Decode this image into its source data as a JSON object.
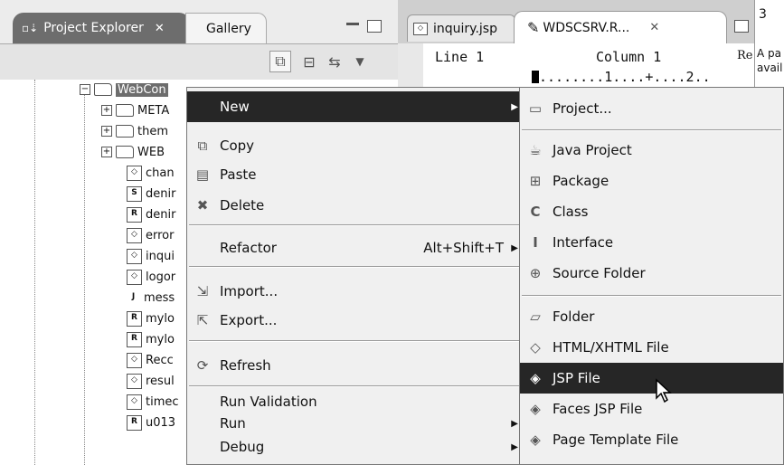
{
  "left_panel": {
    "tabs": [
      {
        "label": "Project Explorer",
        "close": "✕"
      },
      {
        "label": "Gallery"
      }
    ],
    "tree": {
      "root": "WebCon",
      "children": [
        {
          "label": "META",
          "kind": "folder"
        },
        {
          "label": "them",
          "kind": "folder"
        },
        {
          "label": "WEB",
          "kind": "folder"
        },
        {
          "label": "chan",
          "kind": "file",
          "glyph": "◇"
        },
        {
          "label": "denir",
          "kind": "file",
          "glyph": "S"
        },
        {
          "label": "denir",
          "kind": "file",
          "glyph": "R"
        },
        {
          "label": "error",
          "kind": "file",
          "glyph": "◇"
        },
        {
          "label": "inqui",
          "kind": "file",
          "glyph": "◇"
        },
        {
          "label": "logor",
          "kind": "file",
          "glyph": "◇"
        },
        {
          "label": "mess",
          "kind": "file",
          "glyph": "J"
        },
        {
          "label": "mylo",
          "kind": "file",
          "glyph": "R"
        },
        {
          "label": "mylo",
          "kind": "file",
          "glyph": "R"
        },
        {
          "label": "Recc",
          "kind": "file",
          "glyph": "◇"
        },
        {
          "label": "resul",
          "kind": "file",
          "glyph": "◇"
        },
        {
          "label": "timec",
          "kind": "file",
          "glyph": "◇"
        },
        {
          "label": "u013",
          "kind": "file",
          "glyph": "R"
        }
      ]
    }
  },
  "editor": {
    "tabs": [
      {
        "label": "inquiry.jsp"
      },
      {
        "label": "WDSCSRV.R...",
        "close": "✕"
      }
    ],
    "line_label": "Line 1",
    "column_label": "Column 1",
    "re_label": "Re",
    "ruler": "........1....+....2.."
  },
  "far_right": {
    "tab_label": "3",
    "text_line1": "A pa",
    "text_line2": "avail"
  },
  "context_menu": {
    "items": [
      {
        "label": "New",
        "icon": "",
        "arrow": "▶",
        "highlight": true
      },
      {
        "label": "Copy",
        "icon": "copy-icon"
      },
      {
        "label": "Paste",
        "icon": "paste-icon"
      },
      {
        "label": "Delete",
        "icon": "delete-icon"
      },
      {
        "label": "Refactor",
        "shortcut": "Alt+Shift+T",
        "arrow": "▶"
      },
      {
        "label": "Import...",
        "icon": "import-icon"
      },
      {
        "label": "Export...",
        "icon": "export-icon"
      },
      {
        "label": "Refresh",
        "icon": "refresh-icon"
      },
      {
        "label": "Run Validation"
      },
      {
        "label": "Run",
        "arrow": "▶"
      },
      {
        "label": "Debug",
        "arrow": "▶"
      }
    ]
  },
  "new_submenu": {
    "items": [
      {
        "label": "Project...",
        "icon": "project-icon"
      },
      {
        "label": "Java Project",
        "icon": "java-project-icon"
      },
      {
        "label": "Package",
        "icon": "package-icon"
      },
      {
        "label": "Class",
        "icon": "class-icon"
      },
      {
        "label": "Interface",
        "icon": "interface-icon"
      },
      {
        "label": "Source Folder",
        "icon": "source-folder-icon"
      },
      {
        "label": "Folder",
        "icon": "folder-icon"
      },
      {
        "label": "HTML/XHTML File",
        "icon": "html-file-icon"
      },
      {
        "label": "JSP File",
        "icon": "jsp-file-icon",
        "highlight": true
      },
      {
        "label": "Faces JSP File",
        "icon": "faces-jsp-icon"
      },
      {
        "label": "Page Template File",
        "icon": "page-template-icon"
      }
    ]
  }
}
